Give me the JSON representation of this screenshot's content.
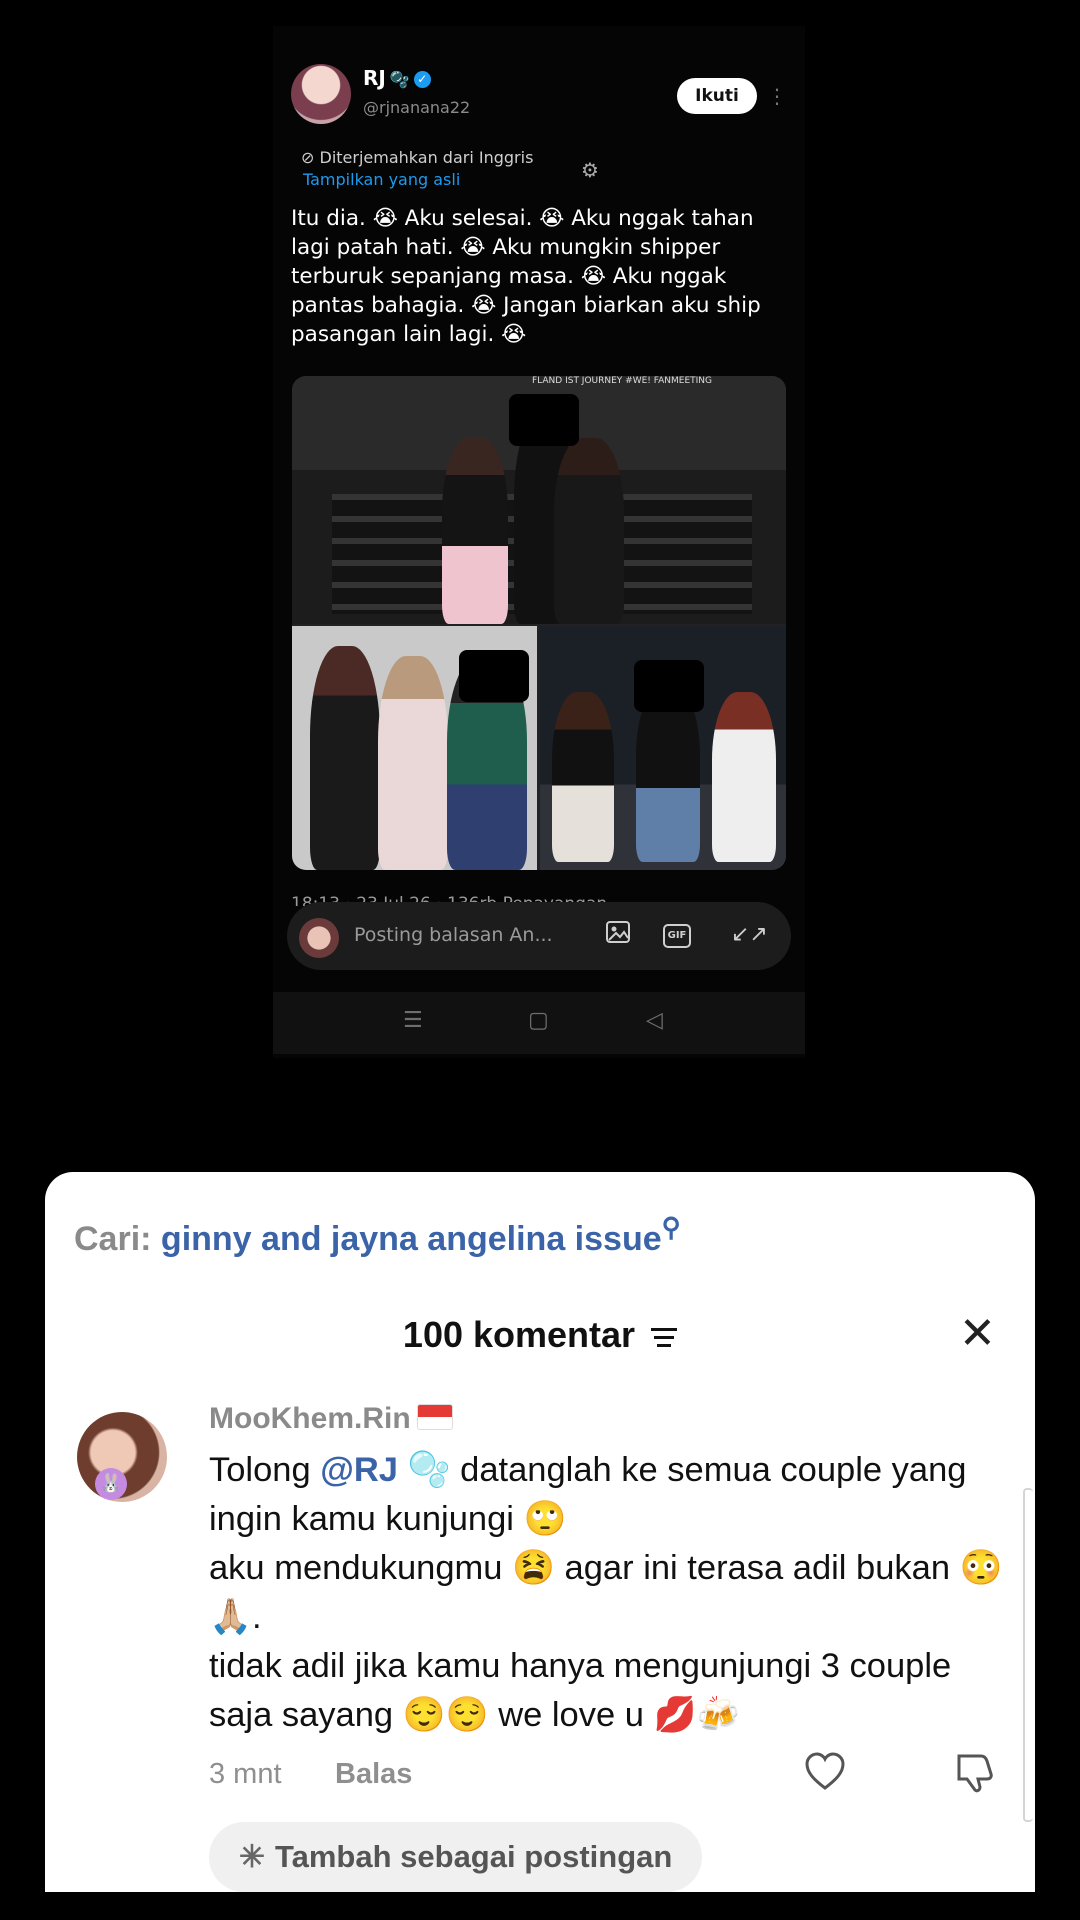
{
  "tweet": {
    "name": "RJ",
    "name_glyph": "🫧",
    "handle": "@rjnanana22",
    "follow_label": "Ikuti",
    "more_glyph": "⋮",
    "translated_note": "Diterjemahkan dari Inggris",
    "translate_icon": "globe-icon",
    "show_original": "Tampilkan yang asli",
    "gear_glyph": "⚙",
    "text": "Itu dia. 😭 Aku selesai. 😭 Aku nggak tahan lagi patah hati. 😭 Aku mungkin shipper terburuk sepanjang masa. 😭 Aku nggak pantas bahagia. 😭 Jangan biarkan aku ship pasangan lain lagi. 😭",
    "media_caption": "FLAND IST JOURNEY\n#WE! FANMEETING",
    "cover_emoji": "😭",
    "meta_partial": "18:13 · 23 Jul 26 · 136rb Penayangan",
    "reply_placeholder": "Posting balasan An...",
    "reply_icons": [
      "image-icon",
      "gif-icon",
      "expand-icon"
    ],
    "gif_label": "GIF",
    "nav_icons": [
      "menu-icon",
      "home-icon",
      "back-icon"
    ]
  },
  "sheet": {
    "search_prefix": "Cari:",
    "search_query": "ginny and jayna angelina issue",
    "search_glyph": "🔍",
    "comment_count": "100 komentar",
    "close_glyph": "✕"
  },
  "comment": {
    "user": "MooKhem.Rin",
    "text_pre": "Tolong ",
    "mention": "@RJ",
    "text_post": " 🫧 datanglah ke semua couple yang ingin kamu kunjungi 🙄\naku mendukungmu 😫 agar ini terasa adil bukan 😳🙏🏼.\ntidak adil jika kamu hanya mengunjungi 3 couple saja sayang 😌😌 we love u 💋🍻",
    "time": "3 mnt",
    "reply_label": "Balas",
    "add_post_label": "Tambah sebagai postingan",
    "avatar_badge": "🐰"
  },
  "colors": {
    "link_blue": "#3b63a8",
    "twitter_blue": "#1d9bf0",
    "muted": "#8a8a8a"
  }
}
